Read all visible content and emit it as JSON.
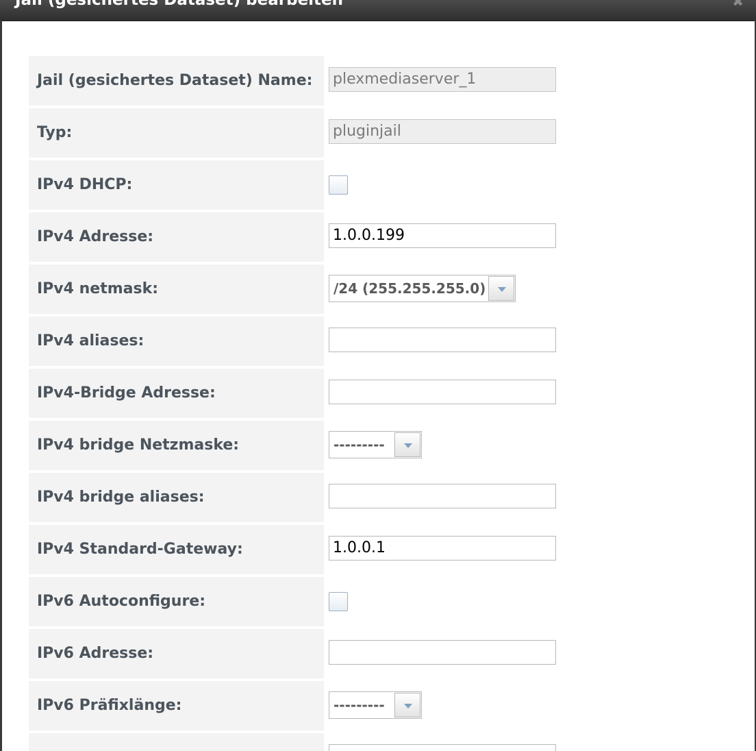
{
  "dialog": {
    "title": "Jail (gesichertes Dataset) bearbeiten",
    "close_icon": "close-icon"
  },
  "fields": {
    "jail_name": {
      "label": "Jail (gesichertes Dataset) Name:",
      "value": "plexmediaserver_1"
    },
    "type": {
      "label": "Typ:",
      "value": "pluginjail"
    },
    "ipv4_dhcp": {
      "label": "IPv4 DHCP:",
      "checked": false
    },
    "ipv4_address": {
      "label": "IPv4 Adresse:",
      "value": "1.0.0.199"
    },
    "ipv4_netmask": {
      "label": "IPv4 netmask:",
      "selected": "/24 (255.255.255.0)"
    },
    "ipv4_aliases": {
      "label": "IPv4 aliases:",
      "value": ""
    },
    "ipv4_bridge_address": {
      "label": "IPv4-Bridge Adresse:",
      "value": ""
    },
    "ipv4_bridge_netmask": {
      "label": "IPv4 bridge Netzmaske:",
      "selected": "---------"
    },
    "ipv4_bridge_aliases": {
      "label": "IPv4 bridge aliases:",
      "value": ""
    },
    "ipv4_default_gateway": {
      "label": "IPv4 Standard-Gateway:",
      "value": "1.0.0.1"
    },
    "ipv6_autoconfigure": {
      "label": "IPv6 Autoconfigure:",
      "checked": false
    },
    "ipv6_address": {
      "label": "IPv6 Adresse:",
      "value": ""
    },
    "ipv6_prefix_length": {
      "label": "IPv6 Präfixlänge:",
      "selected": "---------"
    }
  }
}
